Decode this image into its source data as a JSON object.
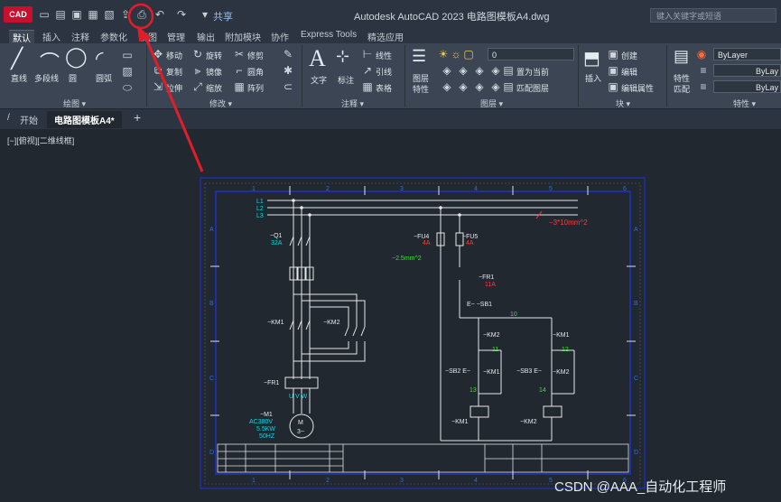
{
  "app": {
    "logo_text": "CAD",
    "title": "Autodesk AutoCAD 2023    电路图模板A4.dwg",
    "search_placeholder": "键入关键字或短语",
    "share_label": "共享"
  },
  "ribbon_tabs": [
    "默认",
    "插入",
    "注释",
    "参数化",
    "视图",
    "管理",
    "输出",
    "附加模块",
    "协作",
    "Express Tools",
    "精选应用"
  ],
  "panels": {
    "draw": {
      "label": "绘图 ▾",
      "items": [
        "直线",
        "多段线",
        "圆",
        "圆弧"
      ]
    },
    "modify": {
      "label": "修改 ▾",
      "items": [
        "移动",
        "旋转",
        "修剪",
        "复制",
        "镜像",
        "圆角",
        "拉伸",
        "缩放",
        "阵列"
      ]
    },
    "annotation": {
      "label": "注释 ▾",
      "items": [
        "文字",
        "标注",
        "线性",
        "引线",
        "表格"
      ]
    },
    "layers": {
      "label": "图层 ▾",
      "layer_props": "图层\n特性",
      "layer_name": "0",
      "items": [
        "置为当前",
        "匹配图层"
      ],
      "props_label": "图层",
      "props_label2": "特性"
    },
    "block": {
      "label": "块 ▾",
      "insert": "插入",
      "items": [
        "创建",
        "编辑",
        "编辑属性"
      ]
    },
    "properties": {
      "label": "特性 ▾",
      "match": "特性",
      "match2": "匹配",
      "bylayer1": "ByLayer",
      "bylayer2": "ByLay",
      "bylayer3": "ByLay"
    }
  },
  "file_tabs": {
    "start": "开始",
    "current": "电路图模板A4*",
    "add": "+"
  },
  "viewport_label": "[−][俯视][二维线框]",
  "drawing": {
    "col_numbers": [
      "1",
      "2",
      "3",
      "4",
      "5",
      "6"
    ],
    "row_letters": [
      "A",
      "B",
      "C",
      "D"
    ],
    "labels": {
      "l1": "L1",
      "l2": "L2",
      "l3": "L3",
      "q1": "−Q1",
      "q1_rating": "32A",
      "fu4": "−FU4",
      "fu4_rating": "4A",
      "fu5": "−FU5",
      "fu5_rating": "4A",
      "wire_main": "−3*10mm^2",
      "wire_ctrl": "−2.5mm^2",
      "fr1_ctrl": "−FR1",
      "fr1_rating": "11A",
      "sb1": "E−  −SB1",
      "n10": "10",
      "km2_il": "−KM2",
      "km1_il": "−KM1",
      "n11": "11",
      "n12": "12",
      "sb2": "−SB2 E−",
      "sb3": "−SB3 E−",
      "km1_aux": "−KM1",
      "km2_aux": "−KM2",
      "n13": "13",
      "n14": "14",
      "km1_coil": "−KM1",
      "km2_coil": "−KM2",
      "km1_main": "−KM1",
      "km2_main": "−KM2",
      "fr1_main": "−FR1",
      "uvw": "U V W",
      "m1": "−M1",
      "m1_spec1": "AC380V",
      "m1_spec2": "5.5KW",
      "m1_spec3": "50HZ",
      "motor": "M",
      "motor2": "3~"
    }
  },
  "watermark": "CSDN @AAA_自动化工程师",
  "colors": {
    "accent": "#e11d2a",
    "frame_blue": "#2030c8",
    "wire_white": "#e8e8e8",
    "cyan": "#19d3e6",
    "red_text": "#ff3a3a",
    "green_text": "#3ee03e"
  }
}
